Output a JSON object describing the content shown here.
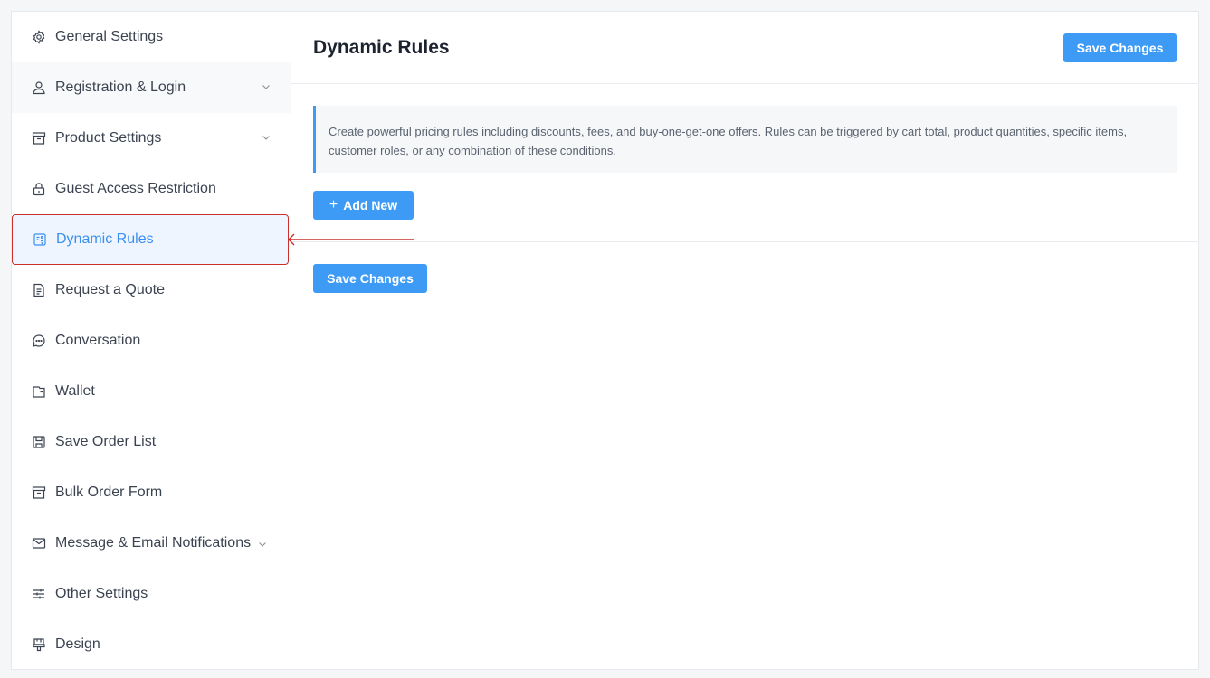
{
  "sidebar": {
    "items": [
      {
        "label": "General Settings",
        "icon": "gear-icon"
      },
      {
        "label": "Registration & Login",
        "icon": "user-icon",
        "has_chevron": true
      },
      {
        "label": "Product Settings",
        "icon": "archive-icon",
        "has_chevron": true
      },
      {
        "label": "Guest Access Restriction",
        "icon": "lock-icon"
      },
      {
        "label": "Dynamic Rules",
        "icon": "rules-icon",
        "active": true
      },
      {
        "label": "Request a Quote",
        "icon": "document-icon"
      },
      {
        "label": "Conversation",
        "icon": "chat-icon"
      },
      {
        "label": "Wallet",
        "icon": "wallet-icon"
      },
      {
        "label": "Save Order List",
        "icon": "save-icon"
      },
      {
        "label": "Bulk Order Form",
        "icon": "archive-icon"
      },
      {
        "label": "Message & Email Notifications",
        "icon": "mail-icon",
        "has_chevron": true
      },
      {
        "label": "Other Settings",
        "icon": "sliders-icon"
      },
      {
        "label": "Design",
        "icon": "design-icon"
      }
    ]
  },
  "main": {
    "title": "Dynamic Rules",
    "save_label": "Save Changes",
    "description": "Create powerful pricing rules including discounts, fees, and buy-one-get-one offers. Rules can be triggered by cart total, product quantities, specific items, customer roles, or any combination of these conditions.",
    "add_new_label": "Add New",
    "add_new_plus": "+",
    "bottom_save_label": "Save Changes"
  },
  "colors": {
    "accent": "#3d9bf5",
    "active_bg": "#eef5ff",
    "highlight_border": "#c9302c"
  }
}
